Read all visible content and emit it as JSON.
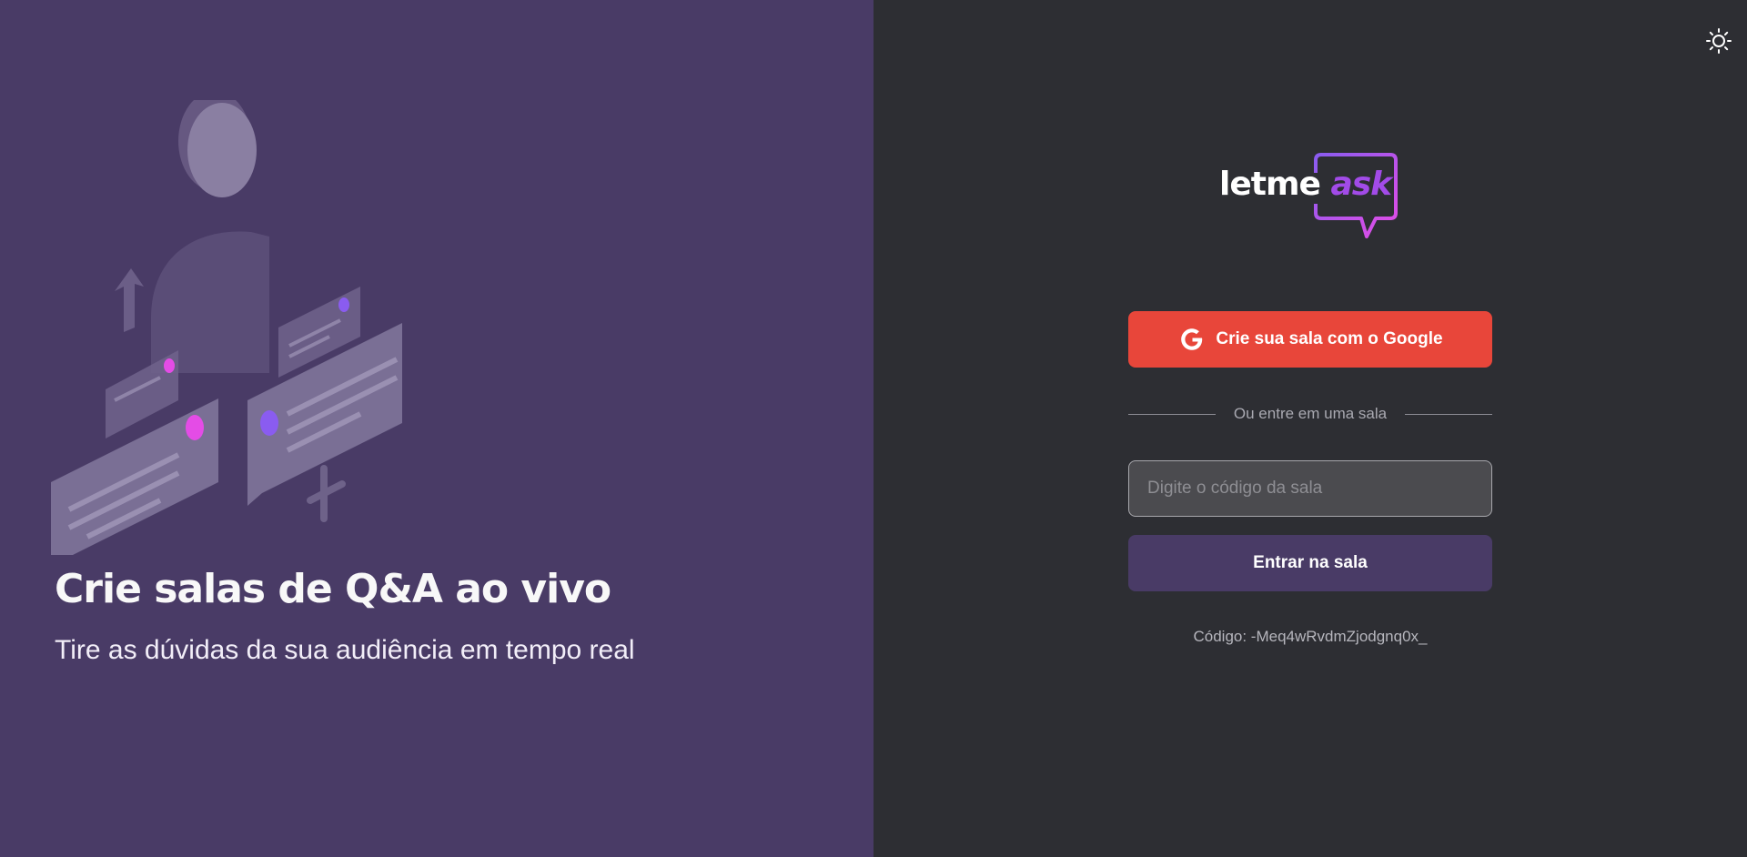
{
  "aside": {
    "title": "Crie salas de Q&A ao vivo",
    "subtitle": "Tire as dúvidas da sua audiência em tempo real",
    "illustration": "qa-illustration"
  },
  "header": {
    "theme_icon": "sun-icon"
  },
  "logo": {
    "text_main": "letme",
    "text_accent": "ask"
  },
  "auth": {
    "google_icon": "google-icon",
    "google_label": "Crie sua sala com o Google",
    "separator_label": "Ou entre em uma sala",
    "room_code_placeholder": "Digite o código da sala",
    "room_code_value": "",
    "enter_label": "Entrar na sala",
    "code_label": "Código: -Meq4wRvdmZjodgnq0x_"
  },
  "colors": {
    "aside_bg": "#493b66",
    "main_bg": "#2d2e33",
    "google_red": "#e8463a",
    "purple": "#493b66",
    "accent": "#a24be8"
  }
}
